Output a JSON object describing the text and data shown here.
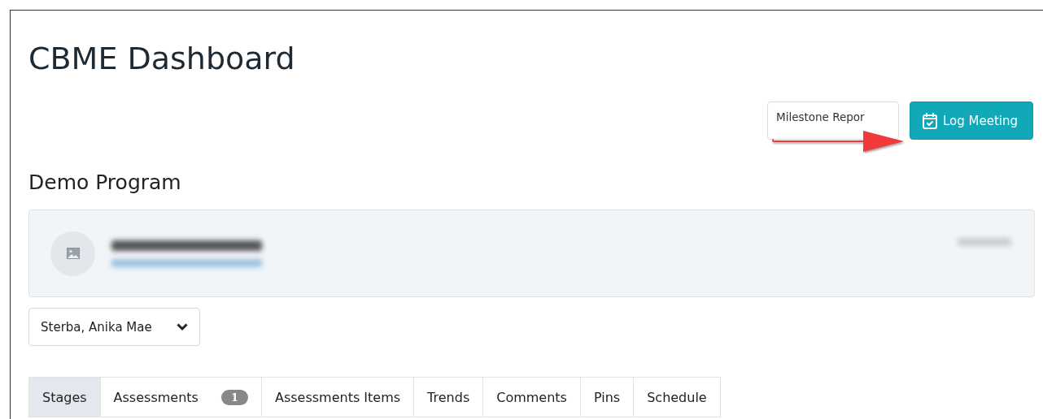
{
  "page": {
    "title": "CBME Dashboard"
  },
  "actions": [
    {
      "label": "Milestone Repor",
      "kind": "secondary"
    },
    {
      "label": "Log Meeting",
      "kind": "primary"
    }
  ],
  "program": "Demo Program",
  "learner_select": {
    "value": "Sterba, Anika Mae"
  },
  "tabs": [
    {
      "label": "Stages",
      "selected": true
    },
    {
      "label": "Assessments",
      "selected": false,
      "badge": "1"
    },
    {
      "label": "Assessments Items",
      "selected": false
    },
    {
      "label": "Trends",
      "selected": false
    },
    {
      "label": "Comments",
      "selected": false
    },
    {
      "label": "Pins",
      "selected": false
    },
    {
      "label": "Schedule",
      "selected": false
    }
  ]
}
